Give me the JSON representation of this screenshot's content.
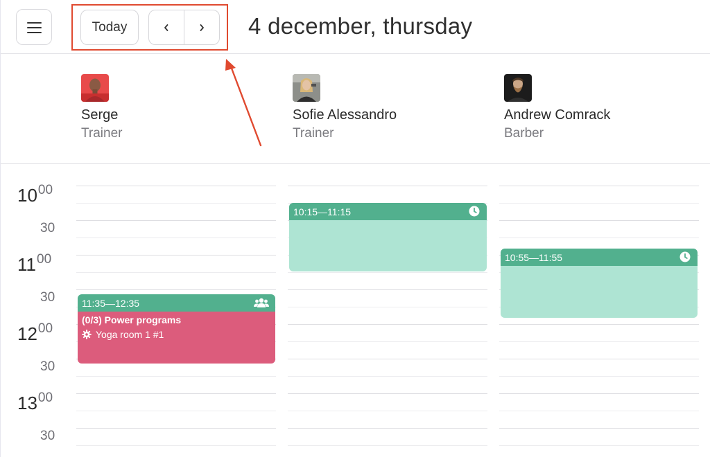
{
  "header": {
    "today_label": "Today",
    "prev_label": "‹",
    "next_label": "›",
    "date_title": "4 december, thursday"
  },
  "staff": [
    {
      "name": "Serge",
      "role": "Trainer",
      "avatar": "avatar-photo"
    },
    {
      "name": "Sofie Alessandro",
      "role": "Trainer",
      "avatar": "avatar-photo"
    },
    {
      "name": "Andrew Comrack",
      "role": "Barber",
      "avatar": "avatar-photo"
    }
  ],
  "time_labels": [
    {
      "hour": "10",
      "mins": "00"
    },
    {
      "half": "30"
    },
    {
      "hour": "11",
      "mins": "00"
    },
    {
      "half": "30"
    },
    {
      "hour": "12",
      "mins": "00"
    },
    {
      "half": "30"
    },
    {
      "hour": "13",
      "mins": "00"
    },
    {
      "half": "30"
    }
  ],
  "events": [
    {
      "staff": "Serge",
      "time": "11:35—12:35",
      "title": "(0/3) Power programs",
      "room": "Yoga room 1 #1",
      "status_icon": "group-icon",
      "room_icon": "gear-icon"
    },
    {
      "staff": "Sofie Alessandro",
      "time": "10:15—11:15",
      "status_icon": "clock-icon"
    },
    {
      "staff": "Andrew Comrack",
      "time": "10:55—11:55",
      "status_icon": "clock-icon"
    }
  ],
  "colors": {
    "accent_green": "#52b08e",
    "event_teal": "#aee4d3",
    "event_pink": "#dc5c7c",
    "highlight_red": "#e04a30"
  }
}
